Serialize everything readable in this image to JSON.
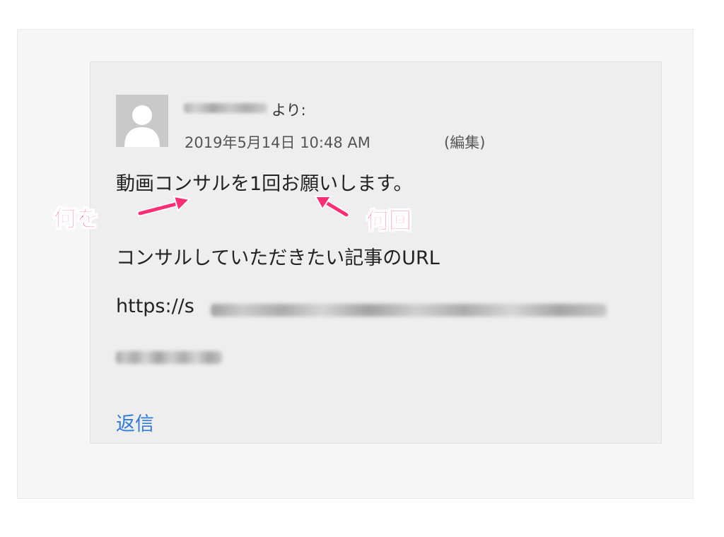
{
  "comment": {
    "author_suffix": "より:",
    "date": "2019年5月14日 10:48 AM",
    "edit_label": "(編集)",
    "body_line1": "動画コンサルを1回お願いします。",
    "body_line2": "コンサルしていただきたい記事のURL",
    "url_prefix": "https://s",
    "reply_label": "返信"
  },
  "annotations": {
    "what_label": "何を",
    "how_many_label": "何回",
    "color": "#ff2e73"
  },
  "icons": {
    "avatar": "default-user-avatar-icon",
    "arrow_what": "arrow-up-right-icon",
    "arrow_how_many": "arrow-up-left-icon"
  }
}
